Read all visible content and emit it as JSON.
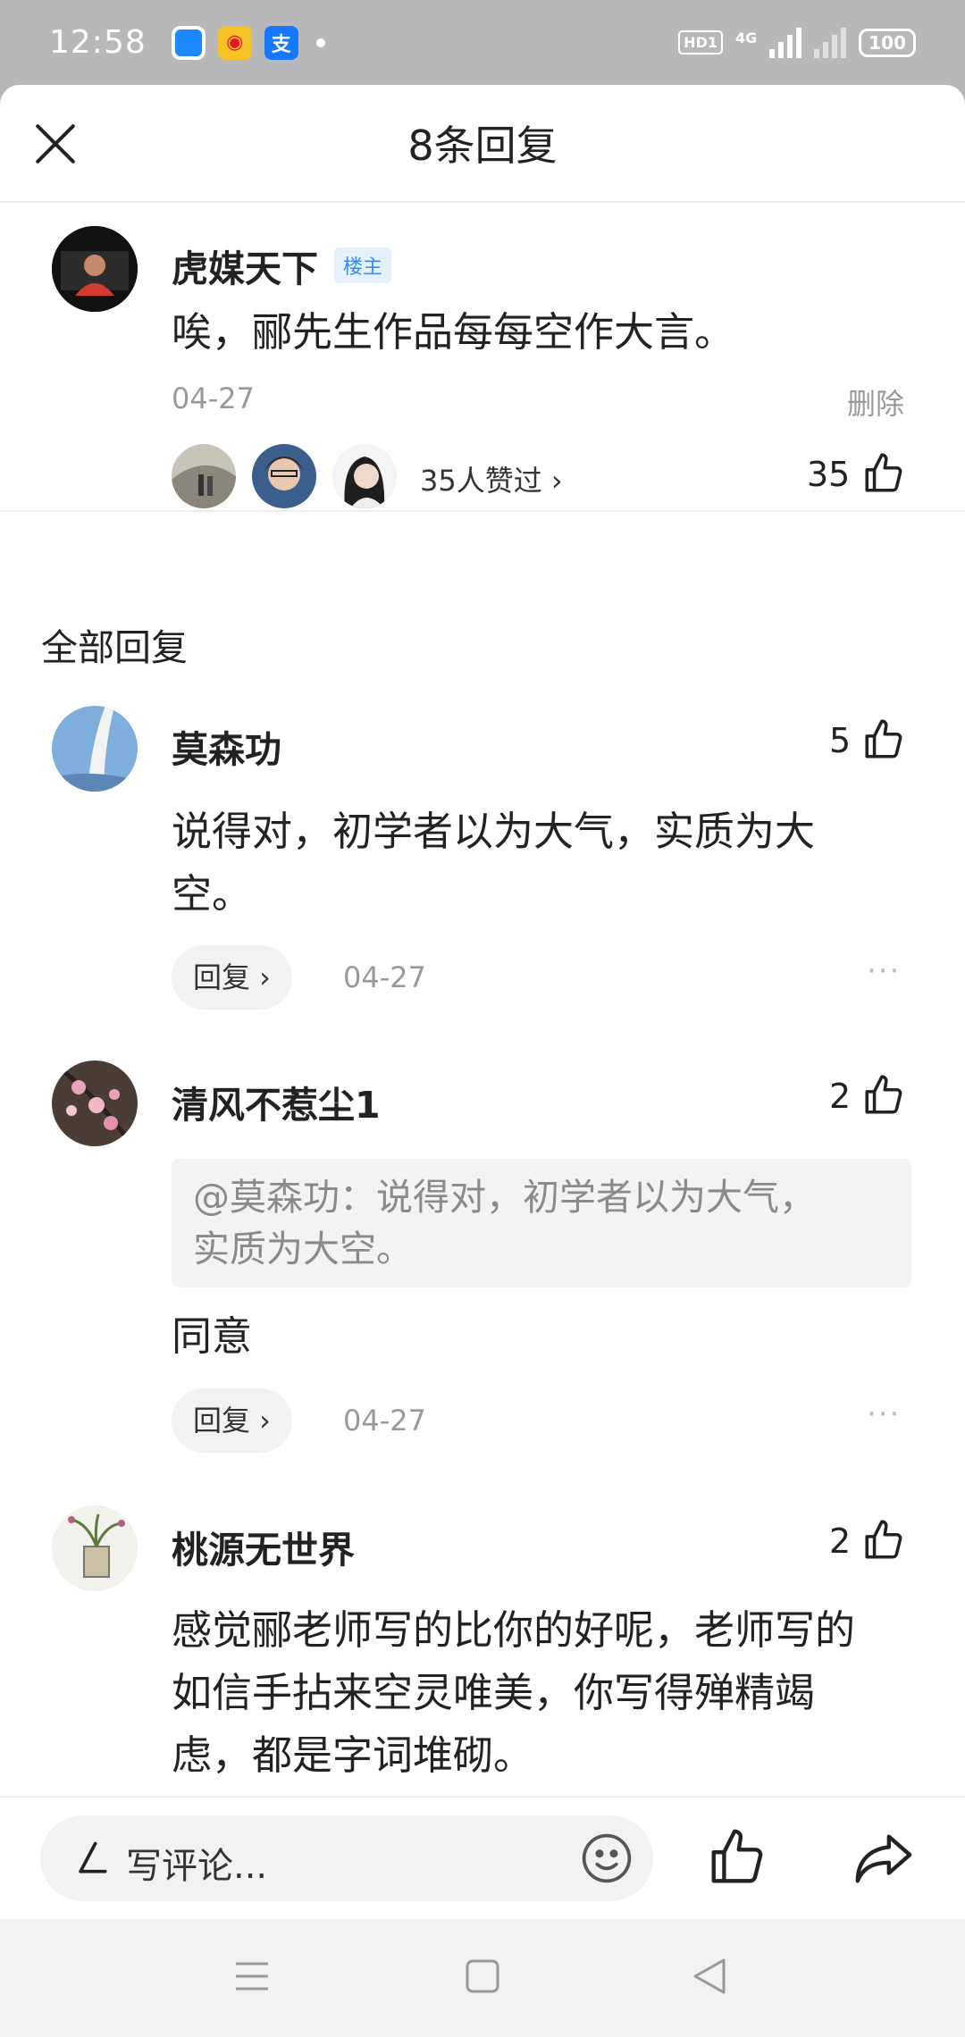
{
  "status_bar": {
    "time": "12:58",
    "network": "4G",
    "battery": "100",
    "hd": "HD1"
  },
  "header": {
    "title": "8条回复"
  },
  "main_comment": {
    "author": "虎媒天下",
    "badge": "楼主",
    "text": "唉，郦先生作品每每空作大言。",
    "date": "04-27",
    "delete_label": "删除",
    "liked_by": "35人赞过 ›",
    "like_count": "35"
  },
  "section_title": "全部回复",
  "replies": [
    {
      "author": "莫森功",
      "likes": "5",
      "text_line1": "说得对，初学者以为大气，实质为大",
      "text_line2": "空。",
      "reply_label": "回复 ›",
      "date": "04-27",
      "more": "···"
    },
    {
      "author": "清风不惹尘1",
      "likes": "2",
      "quote_line1": "@莫森功：说得对，初学者以为大气，",
      "quote_line2": "实质为大空。",
      "text": "同意",
      "reply_label": "回复 ›",
      "date": "04-27",
      "more": "···"
    },
    {
      "author": "桃源无世界",
      "likes": "2",
      "text_line1": "感觉郦老师写的比你的好呢，老师写的",
      "text_line2": "如信手拈来空灵唯美，你写得殚精竭",
      "text_line3": "虑，都是字词堆砌。"
    }
  ],
  "bottom_bar": {
    "placeholder": "写评论..."
  },
  "icons": {
    "close": "close-icon",
    "thumb": "thumbs-up-icon",
    "share": "share-icon",
    "emoji": "emoji-icon",
    "pen": "pen-icon"
  }
}
